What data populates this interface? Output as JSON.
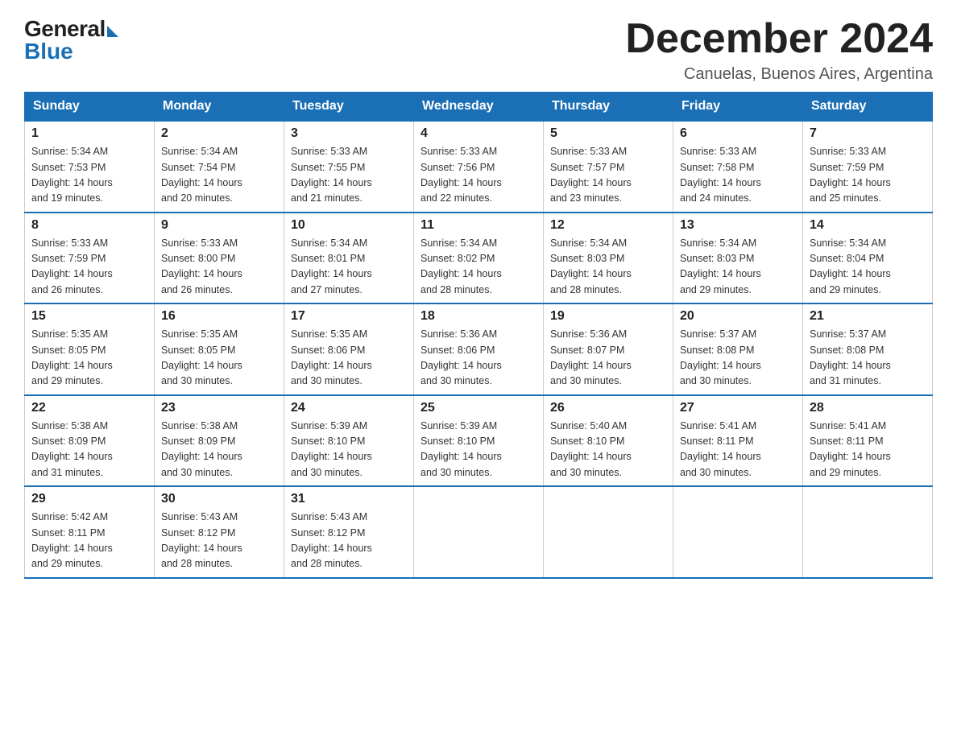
{
  "logo": {
    "general": "General",
    "blue": "Blue"
  },
  "title": "December 2024",
  "location": "Canuelas, Buenos Aires, Argentina",
  "days_of_week": [
    "Sunday",
    "Monday",
    "Tuesday",
    "Wednesday",
    "Thursday",
    "Friday",
    "Saturday"
  ],
  "weeks": [
    [
      {
        "day": "1",
        "sunrise": "5:34 AM",
        "sunset": "7:53 PM",
        "daylight": "14 hours and 19 minutes."
      },
      {
        "day": "2",
        "sunrise": "5:34 AM",
        "sunset": "7:54 PM",
        "daylight": "14 hours and 20 minutes."
      },
      {
        "day": "3",
        "sunrise": "5:33 AM",
        "sunset": "7:55 PM",
        "daylight": "14 hours and 21 minutes."
      },
      {
        "day": "4",
        "sunrise": "5:33 AM",
        "sunset": "7:56 PM",
        "daylight": "14 hours and 22 minutes."
      },
      {
        "day": "5",
        "sunrise": "5:33 AM",
        "sunset": "7:57 PM",
        "daylight": "14 hours and 23 minutes."
      },
      {
        "day": "6",
        "sunrise": "5:33 AM",
        "sunset": "7:58 PM",
        "daylight": "14 hours and 24 minutes."
      },
      {
        "day": "7",
        "sunrise": "5:33 AM",
        "sunset": "7:59 PM",
        "daylight": "14 hours and 25 minutes."
      }
    ],
    [
      {
        "day": "8",
        "sunrise": "5:33 AM",
        "sunset": "7:59 PM",
        "daylight": "14 hours and 26 minutes."
      },
      {
        "day": "9",
        "sunrise": "5:33 AM",
        "sunset": "8:00 PM",
        "daylight": "14 hours and 26 minutes."
      },
      {
        "day": "10",
        "sunrise": "5:34 AM",
        "sunset": "8:01 PM",
        "daylight": "14 hours and 27 minutes."
      },
      {
        "day": "11",
        "sunrise": "5:34 AM",
        "sunset": "8:02 PM",
        "daylight": "14 hours and 28 minutes."
      },
      {
        "day": "12",
        "sunrise": "5:34 AM",
        "sunset": "8:03 PM",
        "daylight": "14 hours and 28 minutes."
      },
      {
        "day": "13",
        "sunrise": "5:34 AM",
        "sunset": "8:03 PM",
        "daylight": "14 hours and 29 minutes."
      },
      {
        "day": "14",
        "sunrise": "5:34 AM",
        "sunset": "8:04 PM",
        "daylight": "14 hours and 29 minutes."
      }
    ],
    [
      {
        "day": "15",
        "sunrise": "5:35 AM",
        "sunset": "8:05 PM",
        "daylight": "14 hours and 29 minutes."
      },
      {
        "day": "16",
        "sunrise": "5:35 AM",
        "sunset": "8:05 PM",
        "daylight": "14 hours and 30 minutes."
      },
      {
        "day": "17",
        "sunrise": "5:35 AM",
        "sunset": "8:06 PM",
        "daylight": "14 hours and 30 minutes."
      },
      {
        "day": "18",
        "sunrise": "5:36 AM",
        "sunset": "8:06 PM",
        "daylight": "14 hours and 30 minutes."
      },
      {
        "day": "19",
        "sunrise": "5:36 AM",
        "sunset": "8:07 PM",
        "daylight": "14 hours and 30 minutes."
      },
      {
        "day": "20",
        "sunrise": "5:37 AM",
        "sunset": "8:08 PM",
        "daylight": "14 hours and 30 minutes."
      },
      {
        "day": "21",
        "sunrise": "5:37 AM",
        "sunset": "8:08 PM",
        "daylight": "14 hours and 31 minutes."
      }
    ],
    [
      {
        "day": "22",
        "sunrise": "5:38 AM",
        "sunset": "8:09 PM",
        "daylight": "14 hours and 31 minutes."
      },
      {
        "day": "23",
        "sunrise": "5:38 AM",
        "sunset": "8:09 PM",
        "daylight": "14 hours and 30 minutes."
      },
      {
        "day": "24",
        "sunrise": "5:39 AM",
        "sunset": "8:10 PM",
        "daylight": "14 hours and 30 minutes."
      },
      {
        "day": "25",
        "sunrise": "5:39 AM",
        "sunset": "8:10 PM",
        "daylight": "14 hours and 30 minutes."
      },
      {
        "day": "26",
        "sunrise": "5:40 AM",
        "sunset": "8:10 PM",
        "daylight": "14 hours and 30 minutes."
      },
      {
        "day": "27",
        "sunrise": "5:41 AM",
        "sunset": "8:11 PM",
        "daylight": "14 hours and 30 minutes."
      },
      {
        "day": "28",
        "sunrise": "5:41 AM",
        "sunset": "8:11 PM",
        "daylight": "14 hours and 29 minutes."
      }
    ],
    [
      {
        "day": "29",
        "sunrise": "5:42 AM",
        "sunset": "8:11 PM",
        "daylight": "14 hours and 29 minutes."
      },
      {
        "day": "30",
        "sunrise": "5:43 AM",
        "sunset": "8:12 PM",
        "daylight": "14 hours and 28 minutes."
      },
      {
        "day": "31",
        "sunrise": "5:43 AM",
        "sunset": "8:12 PM",
        "daylight": "14 hours and 28 minutes."
      },
      null,
      null,
      null,
      null
    ]
  ],
  "labels": {
    "sunrise": "Sunrise:",
    "sunset": "Sunset:",
    "daylight": "Daylight:"
  }
}
